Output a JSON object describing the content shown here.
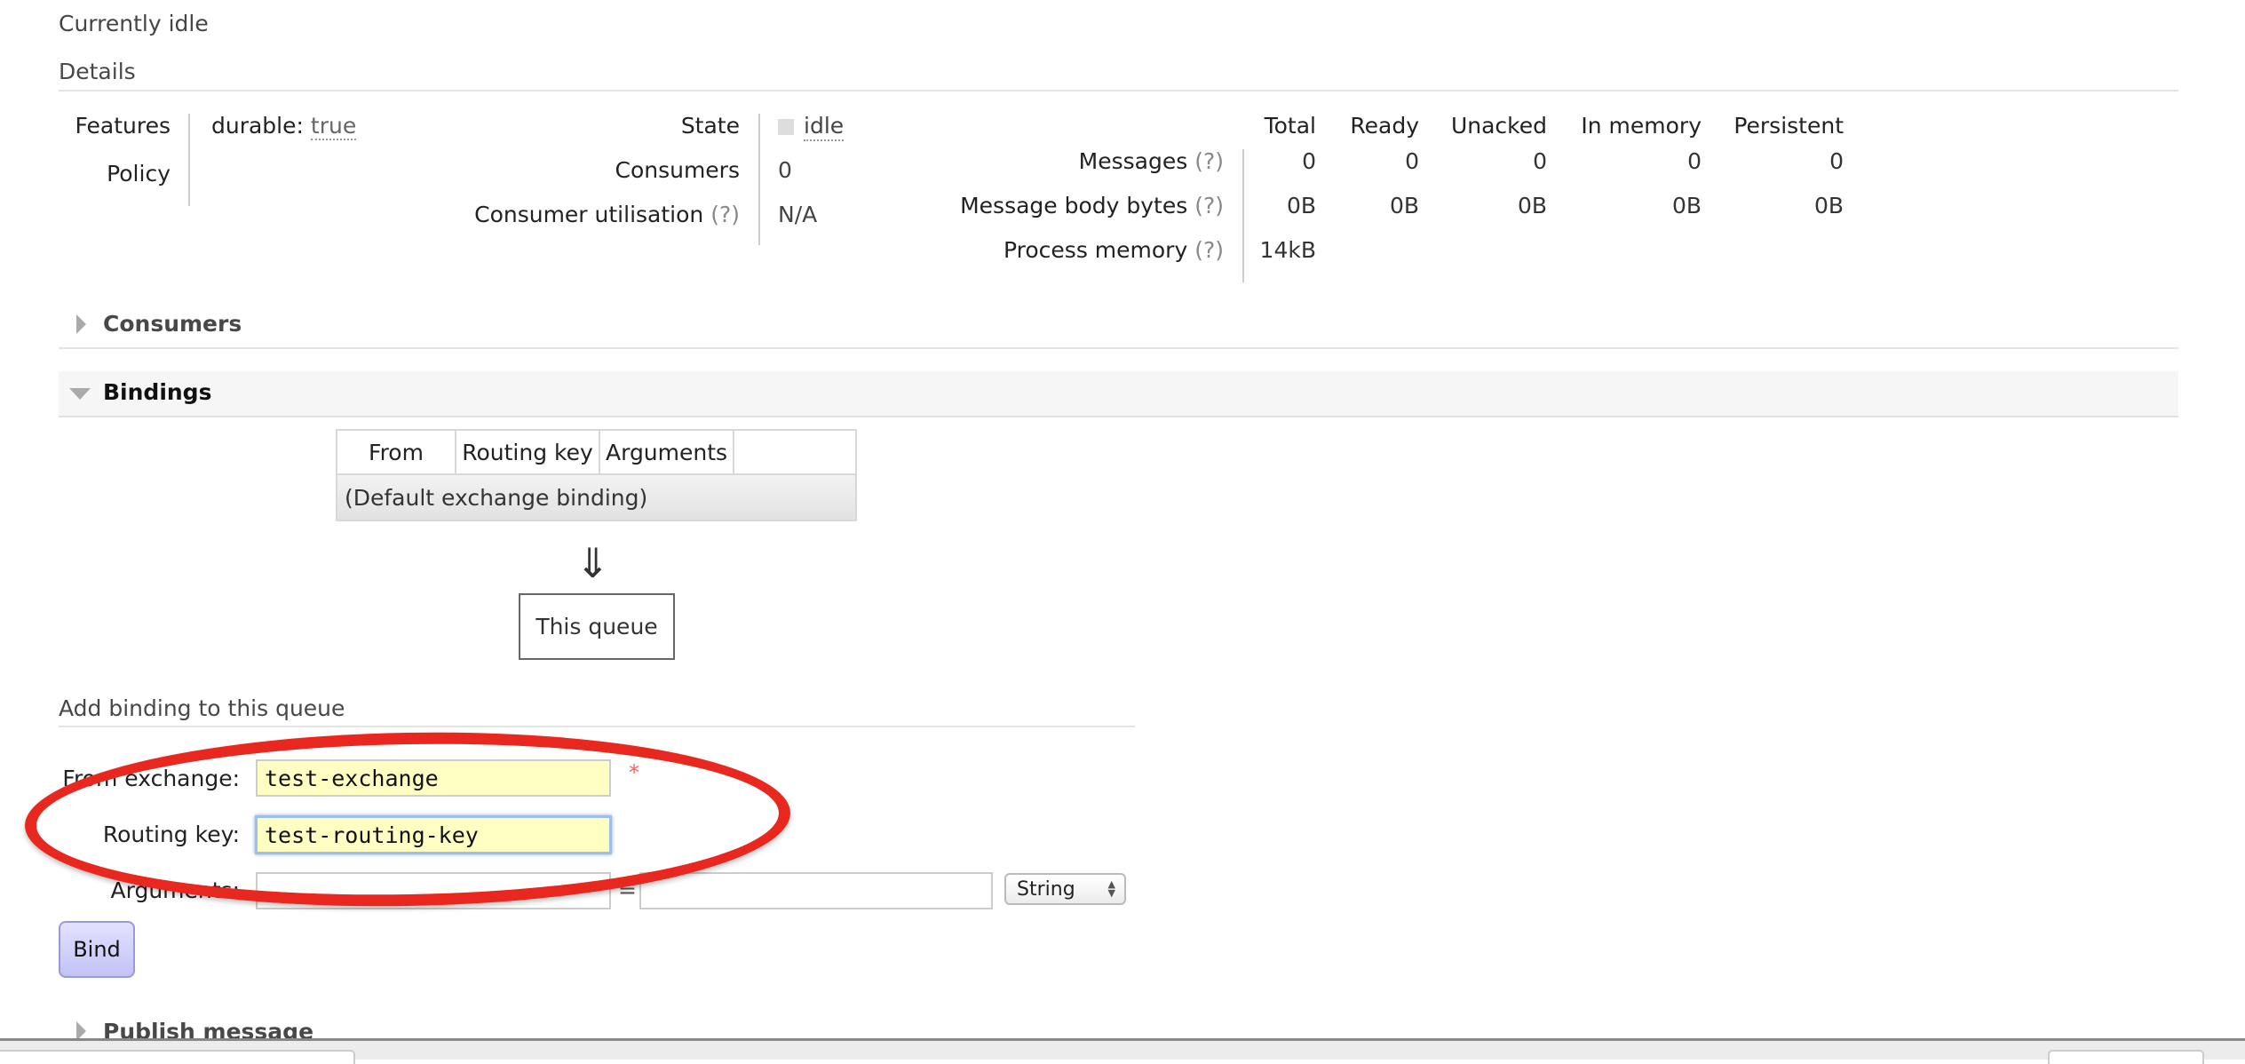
{
  "status_line": "Currently idle",
  "details": {
    "title": "Details",
    "features_label": "Features",
    "features_key": "durable:",
    "features_value": "true",
    "policy_label": "Policy",
    "state_label": "State",
    "state_value": "idle",
    "consumers_label": "Consumers",
    "consumers_value": "0",
    "utilisation_label": "Consumer utilisation",
    "utilisation_value": "N/A",
    "help": "(?)"
  },
  "stats": {
    "columns": [
      "Total",
      "Ready",
      "Unacked",
      "In memory",
      "Persistent"
    ],
    "rows": [
      {
        "label": "Messages",
        "values": [
          "0",
          "0",
          "0",
          "0",
          "0"
        ]
      },
      {
        "label": "Message body bytes",
        "values": [
          "0B",
          "0B",
          "0B",
          "0B",
          "0B"
        ]
      },
      {
        "label": "Process memory",
        "values": [
          "14kB"
        ]
      }
    ]
  },
  "sections": {
    "consumers": "Consumers",
    "bindings": "Bindings",
    "publish": "Publish message"
  },
  "bindings_table": {
    "headers": [
      "From",
      "Routing key",
      "Arguments",
      ""
    ],
    "rows": [
      "(Default exchange binding)"
    ]
  },
  "diagram": {
    "arrow": "⇓",
    "queue_label": "This queue"
  },
  "add_binding": {
    "title": "Add binding to this queue",
    "from_exchange_label": "From exchange:",
    "from_exchange_value": "test-exchange",
    "required_mark": "*",
    "routing_key_label": "Routing key:",
    "routing_key_value": "test-routing-key",
    "arguments_label": "Arguments:",
    "arguments_key_value": "",
    "arguments_value": "",
    "arguments_separator": "=",
    "type_select": "String",
    "bind_button": "Bind"
  },
  "annotation": {
    "color": "#e8271f",
    "shape": "ellipse"
  }
}
